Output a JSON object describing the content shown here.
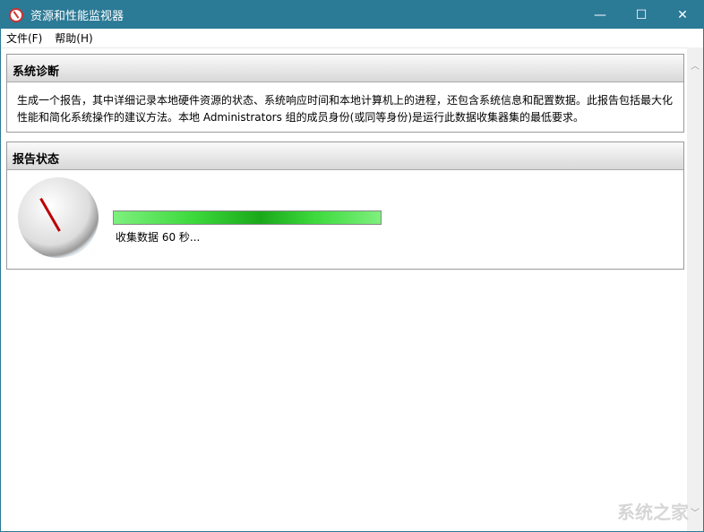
{
  "window": {
    "title": "资源和性能监视器",
    "minimize": "—",
    "maximize": "☐",
    "close": "✕"
  },
  "menu": [
    "文件(F)",
    "帮助(H)"
  ],
  "diagnosis": {
    "title": "系统诊断",
    "description": "生成一个报告，其中详细记录本地硬件资源的状态、系统响应时间和本地计算机上的进程，还包含系统信息和配置数据。此报告包括最大化性能和简化系统操作的建议方法。本地 Administrators 组的成员身份(或同等身份)是运行此数据收集器集的最低要求。"
  },
  "report": {
    "title": "报告状态",
    "status": "收集数据 60 秒...",
    "progress_percent": 100
  },
  "watermark": "系统之家"
}
